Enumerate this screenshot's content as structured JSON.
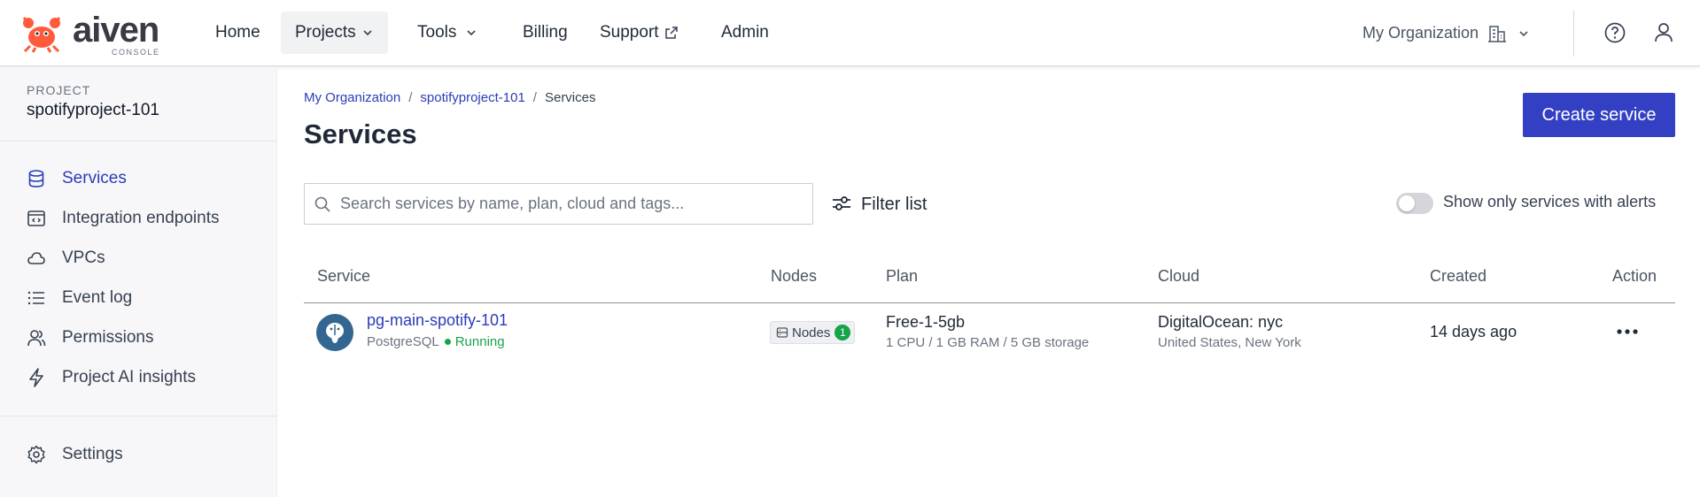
{
  "brand": {
    "name": "aiven",
    "sub": "CONSOLE"
  },
  "nav": {
    "home": "Home",
    "projects": "Projects",
    "tools": "Tools",
    "billing": "Billing",
    "support": "Support",
    "admin": "Admin",
    "organization": "My Organization"
  },
  "sidebar": {
    "project_label": "PROJECT",
    "project_name": "spotifyproject-101",
    "items": [
      {
        "label": "Services",
        "icon": "database-icon",
        "active": true
      },
      {
        "label": "Integration endpoints",
        "icon": "integration-icon"
      },
      {
        "label": "VPCs",
        "icon": "cloud-icon"
      },
      {
        "label": "Event log",
        "icon": "list-icon"
      },
      {
        "label": "Permissions",
        "icon": "users-icon"
      },
      {
        "label": "Project AI insights",
        "icon": "lightning-icon"
      }
    ],
    "settings": "Settings"
  },
  "breadcrumb": {
    "org": "My Organization",
    "project": "spotifyproject-101",
    "current": "Services"
  },
  "page": {
    "title": "Services",
    "create_button": "Create service"
  },
  "toolbar": {
    "search_placeholder": "Search services by name, plan, cloud and tags...",
    "filter_label": "Filter list",
    "alerts_toggle_label": "Show only services with alerts",
    "alerts_toggle_on": false
  },
  "table": {
    "headers": {
      "service": "Service",
      "nodes": "Nodes",
      "plan": "Plan",
      "cloud": "Cloud",
      "created": "Created",
      "action": "Action"
    },
    "rows": [
      {
        "name": "pg-main-spotify-101",
        "type": "PostgreSQL",
        "status": "Running",
        "nodes_label": "Nodes",
        "nodes_count": "1",
        "plan": "Free-1-5gb",
        "plan_detail": "1 CPU / 1 GB RAM / 5 GB storage",
        "cloud": "DigitalOcean: nyc",
        "cloud_region": "United States, New York",
        "created": "14 days ago"
      }
    ]
  },
  "colors": {
    "accent": "#3340c4",
    "link": "#2b3cb8",
    "running": "#16a34a",
    "postgres": "#336791"
  }
}
